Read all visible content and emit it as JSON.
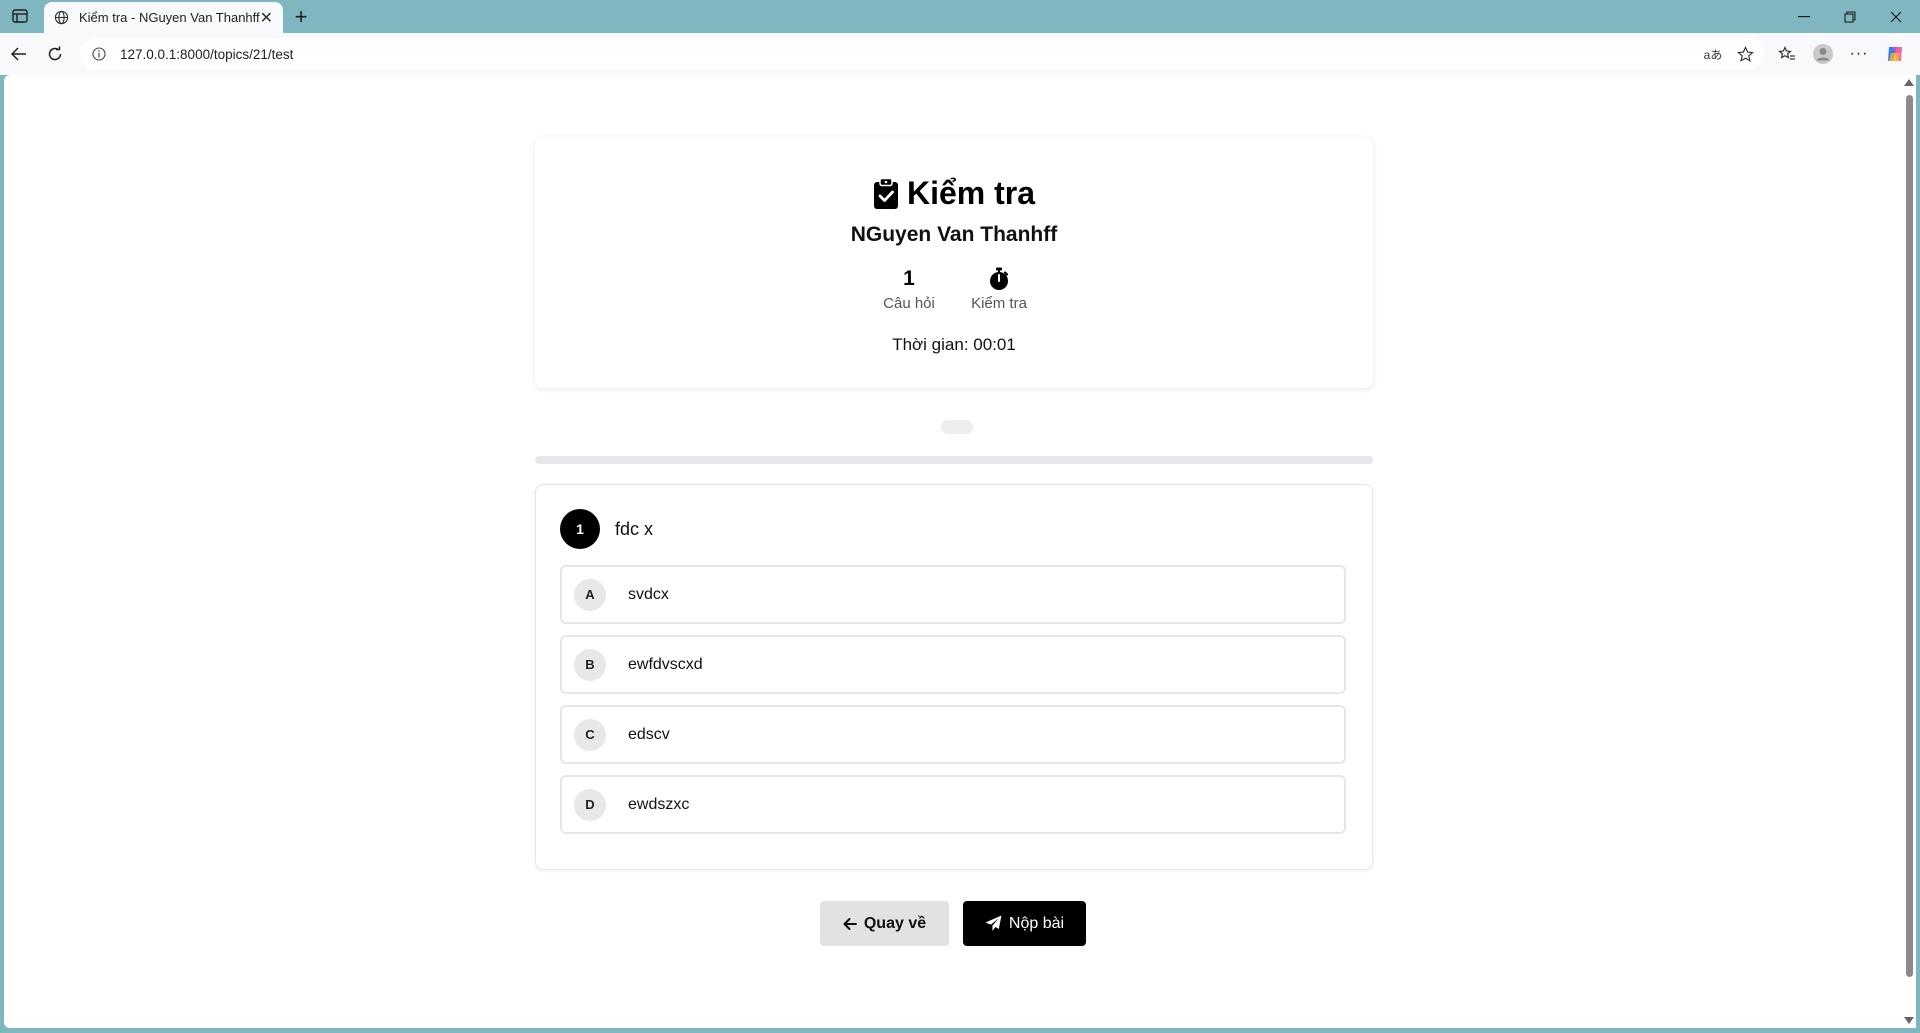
{
  "browser": {
    "tab_title": "Kiểm tra - NGuyen Van Thanhff",
    "url": "127.0.0.1:8000/topics/21/test",
    "window_controls": [
      "minimize-icon",
      "restore-icon",
      "close-icon"
    ],
    "toolbar_icons": [
      "read-aloud-icon",
      "favorite-star-icon",
      "favorites-icon",
      "profile-avatar",
      "more-icon",
      "copilot-icon"
    ]
  },
  "header": {
    "title": "Kiểm tra",
    "subject": "NGuyen Van Thanhff",
    "stats": {
      "questions_value": "1",
      "questions_label": "Câu hỏi",
      "mode_label": "Kiểm tra"
    },
    "timer": "Thời gian: 00:01"
  },
  "progress": {
    "fraction": 0
  },
  "question": {
    "number": "1",
    "text": "fdc x",
    "options": [
      {
        "letter": "A",
        "text": "svdcx"
      },
      {
        "letter": "B",
        "text": "ewfdvscxd"
      },
      {
        "letter": "C",
        "text": "edscv"
      },
      {
        "letter": "D",
        "text": "ewdszxc"
      }
    ]
  },
  "actions": {
    "back_label": "Quay về",
    "submit_label": "Nộp bài"
  },
  "colors": {
    "chrome": "#7fb6bf",
    "accent": "#000000",
    "back_button": "#e2e2e2"
  }
}
